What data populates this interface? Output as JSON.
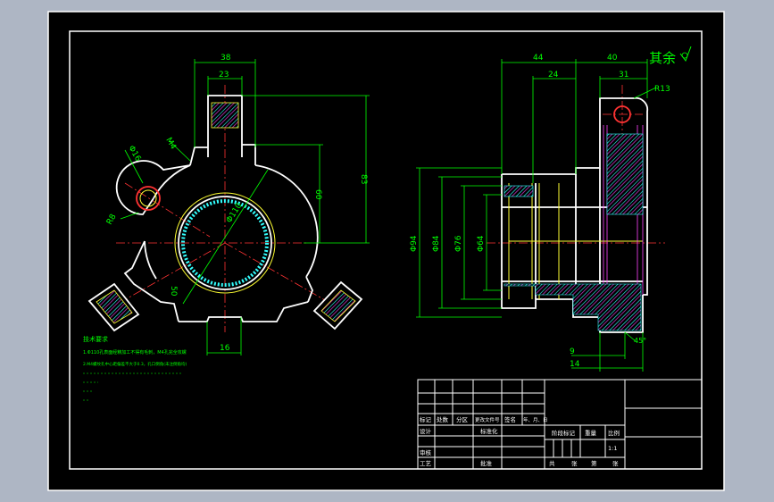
{
  "colors": {
    "background": "#aeb6c4",
    "sheet": "#000000",
    "outline": "#ffffff",
    "dimension": "#00ff00",
    "centerline": "#ff3333",
    "hatch": "#33ffff",
    "yellow": "#ffff33",
    "magenta": "#ff44ff",
    "cyan": "#00ffff"
  },
  "front_view": {
    "dims": {
      "top_outer": "38",
      "top_inner": "23",
      "height_right_outer": "83",
      "height_right_inner": "60",
      "ear_dia": "Φ16",
      "ear_radius": "R8",
      "thread_m": "M4",
      "bore_dia": "Φ110",
      "angle_dim": "50",
      "bottom_width": "16"
    }
  },
  "side_view": {
    "dims": {
      "top_44": "44",
      "top_40": "40",
      "top_24": "24",
      "top_31": "31",
      "radius": "R13",
      "d94a": "Φ94",
      "d84": "Φ84",
      "d76": "Φ76",
      "d64": "Φ64",
      "bottom_9": "9",
      "bottom_14": "14",
      "angle": "45°"
    },
    "surface_note": "其余"
  },
  "tech_requirements": {
    "title": "技术要求",
    "line1": "1.Φ110孔表面经精加工不得有毛刺，M4孔完全攻螺",
    "line2": "2.M4螺纹孔中心距偏差不大于0.3，孔口倒角(未注倒角均)"
  },
  "title_block": {
    "row1": [
      "标记",
      "处数",
      "分区",
      "更改文件号",
      "签名",
      "年、月、日"
    ],
    "row2": [
      "设计",
      "",
      "",
      "标准化",
      "",
      ""
    ],
    "row3": [
      "审核",
      "",
      "",
      "",
      "",
      ""
    ],
    "row4": [
      "工艺",
      "",
      "",
      "批准",
      "",
      ""
    ],
    "stage_marks": "阶段标记",
    "weight": "重量",
    "scale_label": "比例",
    "scale_value": "1:1",
    "sheets": [
      "共",
      "张",
      "第",
      "张"
    ]
  }
}
